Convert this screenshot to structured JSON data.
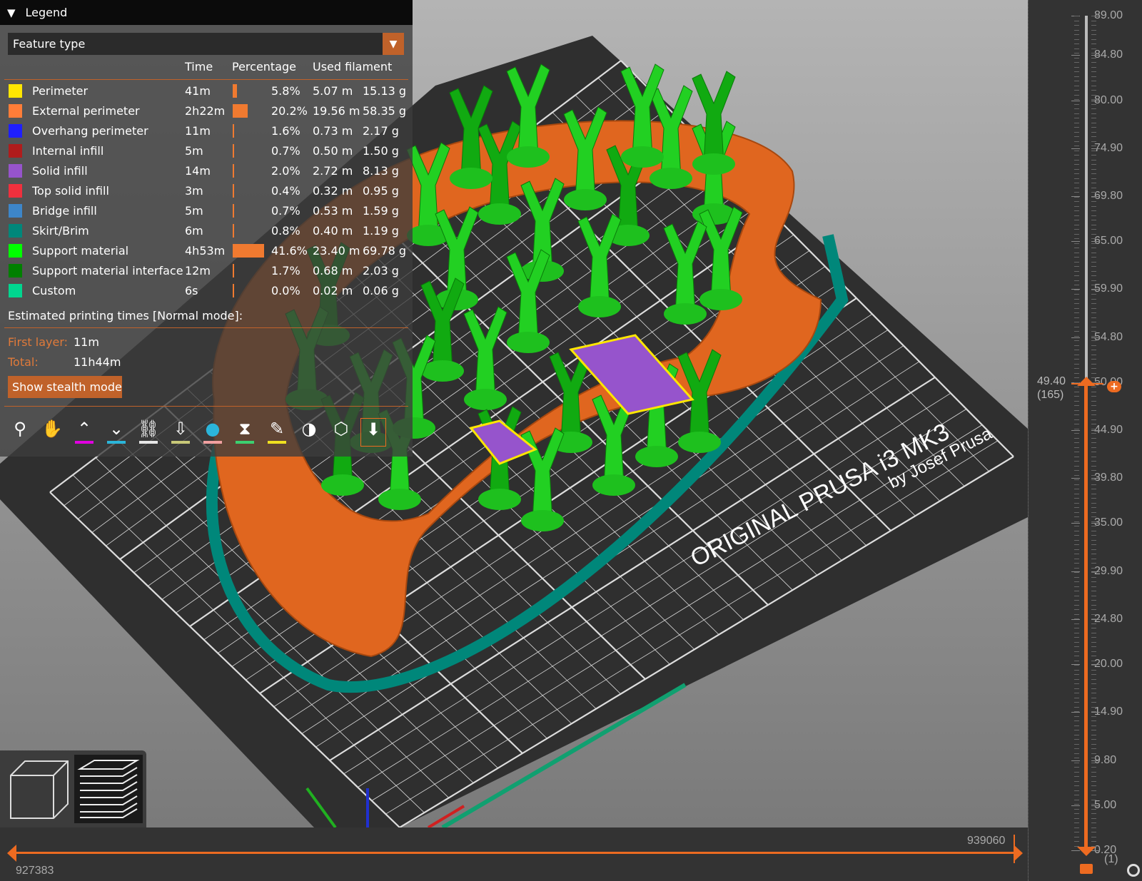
{
  "legend": {
    "title": "Legend",
    "view_type": "Feature type",
    "columns": [
      "Time",
      "Percentage",
      "Used filament"
    ],
    "rows": [
      {
        "name": "Perimeter",
        "color": "#FFE600",
        "time": "41m",
        "percent": 5.8,
        "percent_label": "5.8%",
        "length": "5.07 m",
        "weight": "15.13 g"
      },
      {
        "name": "External perimeter",
        "color": "#FF7D38",
        "time": "2h22m",
        "percent": 20.2,
        "percent_label": "20.2%",
        "length": "19.56 m",
        "weight": "58.35 g"
      },
      {
        "name": "Overhang perimeter",
        "color": "#1F1FFF",
        "time": "11m",
        "percent": 1.6,
        "percent_label": "1.6%",
        "length": "0.73 m",
        "weight": "2.17 g"
      },
      {
        "name": "Internal infill",
        "color": "#B01C1C",
        "time": "5m",
        "percent": 0.7,
        "percent_label": "0.7%",
        "length": "0.50 m",
        "weight": "1.50 g"
      },
      {
        "name": "Solid infill",
        "color": "#9654CC",
        "time": "14m",
        "percent": 2.0,
        "percent_label": "2.0%",
        "length": "2.72 m",
        "weight": "8.13 g"
      },
      {
        "name": "Top solid infill",
        "color": "#F0303D",
        "time": "3m",
        "percent": 0.4,
        "percent_label": "0.4%",
        "length": "0.32 m",
        "weight": "0.95 g"
      },
      {
        "name": "Bridge infill",
        "color": "#3D86C9",
        "time": "5m",
        "percent": 0.7,
        "percent_label": "0.7%",
        "length": "0.53 m",
        "weight": "1.59 g"
      },
      {
        "name": "Skirt/Brim",
        "color": "#00877A",
        "time": "6m",
        "percent": 0.8,
        "percent_label": "0.8%",
        "length": "0.40 m",
        "weight": "1.19 g"
      },
      {
        "name": "Support material",
        "color": "#00FF00",
        "time": "4h53m",
        "percent": 41.6,
        "percent_label": "41.6%",
        "length": "23.40 m",
        "weight": "69.78 g"
      },
      {
        "name": "Support material interface",
        "color": "#008000",
        "time": "12m",
        "percent": 1.7,
        "percent_label": "1.7%",
        "length": "0.68 m",
        "weight": "2.03 g"
      },
      {
        "name": "Custom",
        "color": "#00D68F",
        "time": "6s",
        "percent": 0.0,
        "percent_label": "0.0%",
        "length": "0.02 m",
        "weight": "0.06 g"
      }
    ],
    "estimated_title": "Estimated printing times [Normal mode]:",
    "first_layer_label": "First layer:",
    "first_layer": "11m",
    "total_label": "Total:",
    "total": "11h44m",
    "stealth_button": "Show stealth mode",
    "toolbar": [
      {
        "icon": "travel-icon",
        "color": ""
      },
      {
        "icon": "wipe-icon",
        "color": ""
      },
      {
        "icon": "retractions-icon",
        "color": "#E000E0"
      },
      {
        "icon": "deretractions-icon",
        "color": "#2BB5DA"
      },
      {
        "icon": "seams-icon",
        "color": "#E6E6E6"
      },
      {
        "icon": "tool-changes-icon",
        "color": "#C8C878"
      },
      {
        "icon": "color-changes-icon",
        "color": "#F0A0A0"
      },
      {
        "icon": "pause-icon",
        "color": "#3CD070"
      },
      {
        "icon": "custom-gcode-icon",
        "color": "#F0E020"
      },
      {
        "icon": "center-of-gravity-icon",
        "color": ""
      },
      {
        "icon": "shells-icon",
        "color": ""
      },
      {
        "icon": "tool-marker-icon",
        "color": ""
      }
    ]
  },
  "accent": "#ED6B21",
  "vertical_slider": {
    "ticks": [
      "89.00",
      "84.80",
      "80.00",
      "74.90",
      "69.80",
      "65.00",
      "59.90",
      "54.80",
      "50.00",
      "44.90",
      "39.80",
      "35.00",
      "29.90",
      "24.80",
      "20.00",
      "14.90",
      "9.80",
      "5.00",
      "0.20"
    ],
    "upper_value": "49.40",
    "upper_layer": "(165)",
    "lower_value": "0.20",
    "lower_layer": "(1)",
    "max": 89.0,
    "min": 0.2,
    "upper": 49.4
  },
  "horizontal_slider": {
    "left_value": "927383",
    "right_value": "939060"
  },
  "bed": {
    "label_line1": "ORIGINAL PRUSA i3 MK3",
    "label_line2": "by Josef Prusa"
  }
}
